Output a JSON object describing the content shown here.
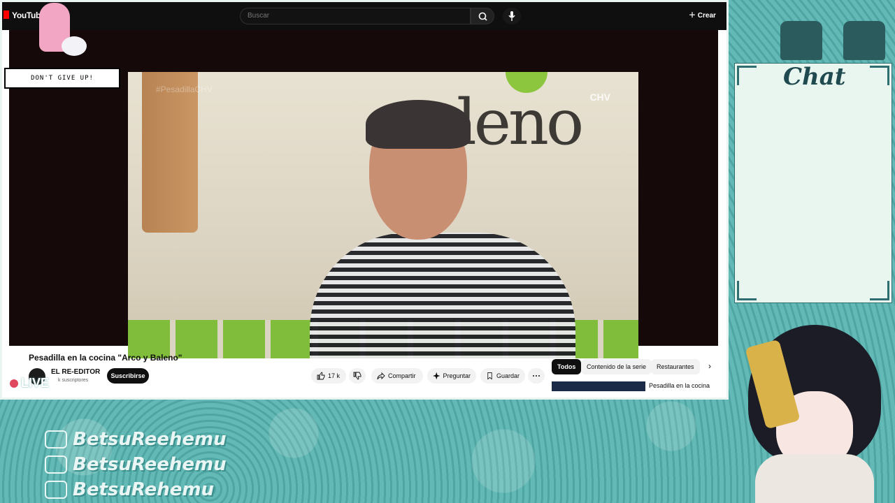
{
  "youtube": {
    "logo": "YouTube",
    "search_placeholder": "Buscar",
    "create_label": "Crear",
    "video_title": "Pesadilla en la cocina \"Arco y Baleno\"",
    "channel_name": "EL RE-EDITOR",
    "channel_subs": "k suscriptores",
    "subscribe_label": "Suscribirse",
    "likes": "17 k",
    "share_label": "Compartir",
    "ask_label": "Preguntar",
    "save_label": "Guardar",
    "chips": [
      "Todos",
      "Contenido de la serie",
      "Restaurantes"
    ],
    "rec_title": "Pesadilla en la cocina",
    "video_watermark": "CHV",
    "video_hashtag": "#PesadillaCHV"
  },
  "overlay": {
    "dont_give_up": "DON'T GIVE UP!",
    "live": "LIVE",
    "chat_title": "Chat",
    "socials": [
      {
        "icon": "instagram-icon",
        "handle": "BetsuReehemu"
      },
      {
        "icon": "youtube-icon",
        "handle": "BetsuReehemu"
      },
      {
        "icon": "twitch-icon",
        "handle": "BetsuRehemu"
      }
    ]
  },
  "colors": {
    "accent_teal": "#5bb3b0",
    "youtube_red": "#ff0000"
  }
}
